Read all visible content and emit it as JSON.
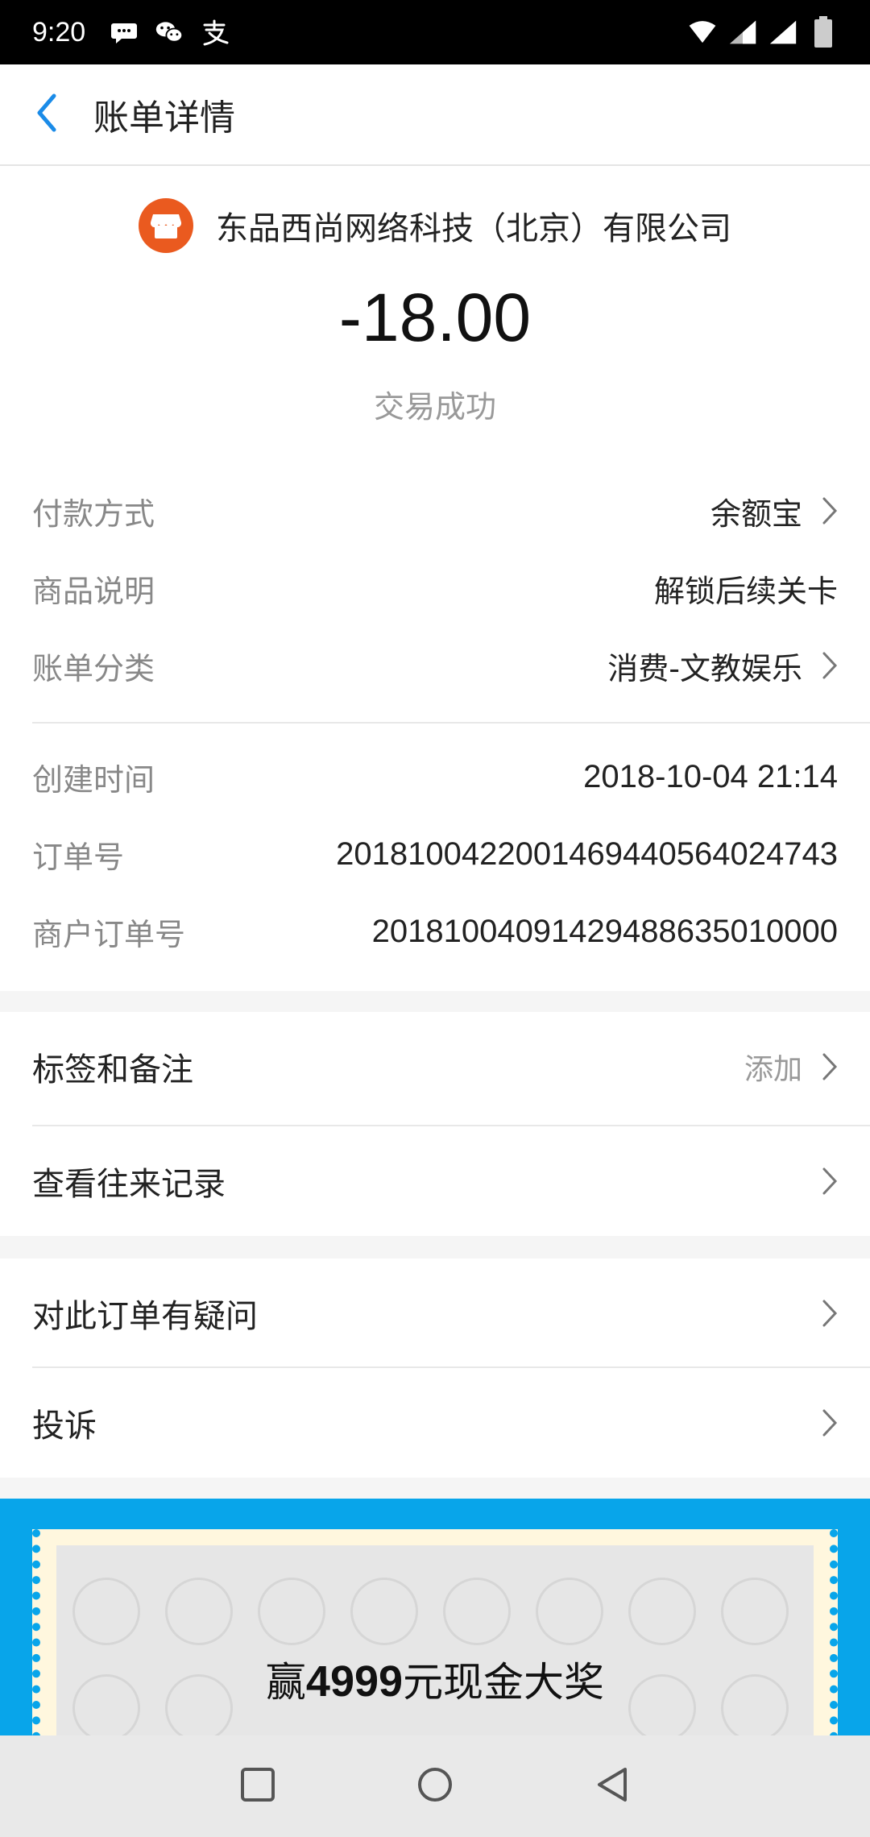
{
  "status_bar": {
    "time": "9:20"
  },
  "header": {
    "title": "账单详情"
  },
  "summary": {
    "merchant": "东品西尚网络科技（北京）有限公司",
    "amount": "-18.00",
    "status": "交易成功"
  },
  "details": [
    {
      "label": "付款方式",
      "value": "余额宝"
    },
    {
      "label": "商品说明",
      "value": "解锁后续关卡"
    },
    {
      "label": "账单分类",
      "value": "消费-文教娱乐"
    },
    {
      "label": "创建时间",
      "value": "2018-10-04 21:14"
    },
    {
      "label": "订单号",
      "value": "2018100422001469440564024743"
    },
    {
      "label": "商户订单号",
      "value": "20181004091429488635010000"
    }
  ],
  "actions": {
    "tags_label": "标签和备注",
    "tags_action": "添加",
    "history_label": "查看往来记录",
    "question_label": "对此订单有疑问",
    "complain_label": "投诉"
  },
  "banner": {
    "prefix": "赢",
    "amount": "4999",
    "suffix": "元现金大奖"
  },
  "colors": {
    "accent": "#1a8be8",
    "merchant_logo": "#ea5a1f",
    "banner_bg": "#08a5ea",
    "cta": "#f3331c"
  },
  "icons": [
    "wechat-message-icon",
    "wechat-icon",
    "alipay-icon",
    "wifi-icon",
    "signal-icon",
    "battery-icon",
    "back-arrow-icon",
    "store-icon",
    "chevron-right-icon",
    "recents-icon",
    "home-icon",
    "back-icon"
  ]
}
